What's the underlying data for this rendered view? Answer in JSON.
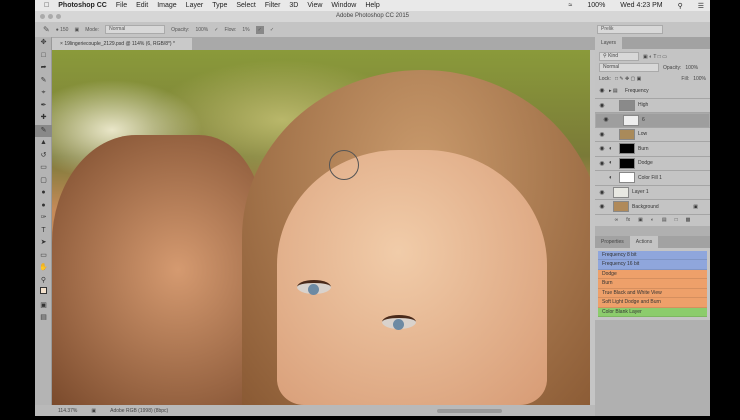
{
  "menubar": {
    "app": "Photoshop CC",
    "items": [
      "File",
      "Edit",
      "Image",
      "Layer",
      "Type",
      "Select",
      "Filter",
      "3D",
      "View",
      "Window",
      "Help"
    ],
    "battery": "100%",
    "clock": "Wed 4:23 PM"
  },
  "window_title": "Adobe Photoshop CC 2015",
  "options": {
    "brush_size": "150",
    "mode_label": "Mode:",
    "mode": "Normal",
    "opacity_label": "Opacity:",
    "opacity": "100%",
    "flow_label": "Flow:",
    "flow": "1%",
    "workspace": "Prelik"
  },
  "doc_tab": "19lingeriecouple_2129.psd @ 114% (6, RGB/8*) *",
  "tools": [
    "move",
    "marquee",
    "lasso",
    "quick-select",
    "crop",
    "eyedropper",
    "healing",
    "brush",
    "stamp",
    "history",
    "eraser",
    "gradient",
    "blur",
    "dodge",
    "pen",
    "type",
    "path-select",
    "shape",
    "hand",
    "zoom"
  ],
  "layers_panel": {
    "tab": "Layers",
    "kind": "Kind",
    "blend": "Normal",
    "opacity_label": "Opacity:",
    "opacity": "100%",
    "lock_label": "Lock:",
    "fill_label": "Fill:",
    "fill": "100%",
    "layers": [
      {
        "name": "Frequency",
        "visible": true,
        "type": "group"
      },
      {
        "name": "High",
        "visible": true,
        "thumb": "#8a8a8a"
      },
      {
        "name": "6",
        "visible": true,
        "thumb": "#eeeeee",
        "selected": true
      },
      {
        "name": "Low",
        "visible": true,
        "thumb": "#a98a5a"
      },
      {
        "name": "Burn",
        "visible": true,
        "thumb": "#000000",
        "adj": true
      },
      {
        "name": "Dodge",
        "visible": true,
        "thumb": "#000000",
        "adj": true
      },
      {
        "name": "Color Fill 1",
        "visible": false,
        "thumb": "#ffffff",
        "adj": true
      },
      {
        "name": "Layer 1",
        "visible": true,
        "thumb": "#e8e8e2"
      },
      {
        "name": "Background",
        "visible": true,
        "thumb": "#b08a5a",
        "locked": true
      }
    ]
  },
  "actions_panel": {
    "tabs": [
      "Properties",
      "Actions"
    ],
    "actions": [
      {
        "name": "Frequency 8 bit",
        "color": "#8fa6dc"
      },
      {
        "name": "Frequency 16 bit",
        "color": "#8fa6dc"
      },
      {
        "name": "Dodge",
        "color": "#eea06a"
      },
      {
        "name": "Burn",
        "color": "#eea06a"
      },
      {
        "name": "True Black and White View",
        "color": "#eea06a"
      },
      {
        "name": "Soft Light Dodge and Burn",
        "color": "#eea06a"
      },
      {
        "name": "Color Blank Layer",
        "color": "#8ccc6c"
      }
    ]
  },
  "status": {
    "zoom": "114.37%",
    "profile": "Adobe RGB (1998) (8bpc)"
  }
}
